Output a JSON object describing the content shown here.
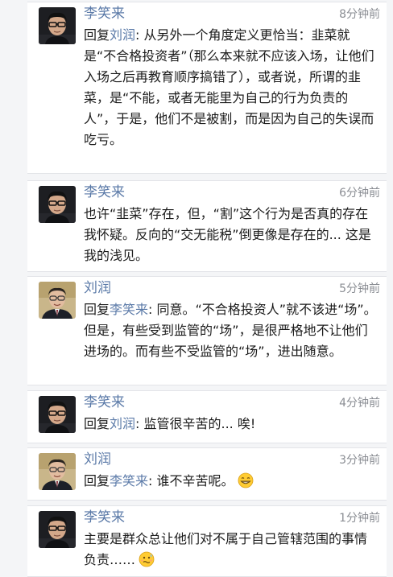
{
  "comments": [
    {
      "author": "李笑来",
      "avatar_icon": "avatar-li-xiaolai",
      "time": "8分钟前",
      "reply_prefix": "回复",
      "reply_to": "刘润",
      "text": ": 从另外一个角度定义更恰当：韭菜就是“不合格投资者”（那么本来就不应该入场，让他们入场之后再教育顺序搞错了），或者说，所谓的韭菜，是“不能，或者无能里为自己的行为负责的人”，于是，他们不是被割，而是因为自己的失误而吃亏。"
    },
    {
      "author": "李笑来",
      "avatar_icon": "avatar-li-xiaolai",
      "time": "6分钟前",
      "text": "也许“韭菜”存在，但，“割”这个行为是否真的存在我怀疑。反向的“交无能税”倒更像是存在的... 这是我的浅见。"
    },
    {
      "author": "刘润",
      "avatar_icon": "avatar-liu-run",
      "time": "5分钟前",
      "reply_prefix": "回复",
      "reply_to": "李笑来",
      "text": ": 同意。“不合格投资人”就不该进“场”。但是，有些受到监管的“场”，是很严格地不让他们进场的。而有些不受监管的“场”，进出随意。"
    },
    {
      "author": "李笑来",
      "avatar_icon": "avatar-li-xiaolai",
      "time": "4分钟前",
      "reply_prefix": "回复",
      "reply_to": "刘润",
      "text": ": 监管很辛苦的... 唉!"
    },
    {
      "author": "刘润",
      "avatar_icon": "avatar-liu-run",
      "time": "3分钟前",
      "reply_prefix": "回复",
      "reply_to": "李笑来",
      "text": ": 谁不辛苦呢。",
      "emoji": "grin-emoji"
    },
    {
      "author": "李笑来",
      "avatar_icon": "avatar-li-xiaolai",
      "time": "1分钟前",
      "text": "主要是群众总让他们对不属于自己管辖范围的事情负责……",
      "emoji": "awkward-emoji"
    }
  ]
}
